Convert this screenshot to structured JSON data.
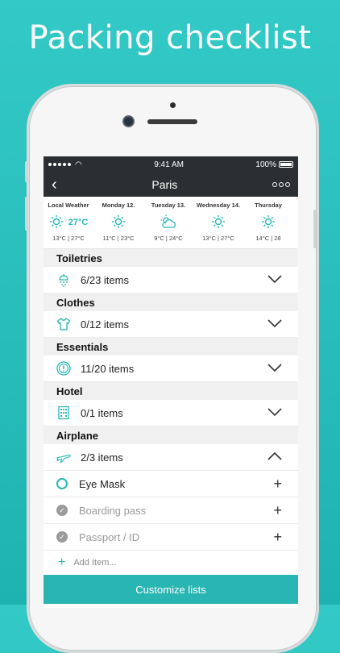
{
  "headline": "Packing checklist",
  "status": {
    "time": "9:41 AM",
    "battery": "100%"
  },
  "nav": {
    "title": "Paris"
  },
  "weather": [
    {
      "day": "Local Weather",
      "icon": "sun-icon",
      "temp": "27°C",
      "range": "13°C | 27°C"
    },
    {
      "day": "Monday 12.",
      "icon": "sun-icon",
      "temp": "",
      "range": "11°C | 23°C"
    },
    {
      "day": "Tuesday 13.",
      "icon": "cloudy-sun-icon",
      "temp": "",
      "range": "9°C | 24°C"
    },
    {
      "day": "Wednesday 14.",
      "icon": "sun-icon",
      "temp": "",
      "range": "13°C | 27°C"
    },
    {
      "day": "Thursday",
      "icon": "sun-icon",
      "temp": "",
      "range": "14°C | 28"
    }
  ],
  "sections": [
    {
      "title": "Toiletries",
      "count": "6/23 items",
      "icon": "shower-icon"
    },
    {
      "title": "Clothes",
      "count": "0/12 items",
      "icon": "tshirt-icon"
    },
    {
      "title": "Essentials",
      "count": "11/20 items",
      "icon": "alert-icon"
    },
    {
      "title": "Hotel",
      "count": "0/1 items",
      "icon": "hotel-icon"
    },
    {
      "title": "Airplane",
      "count": "2/3 items",
      "icon": "airplane-icon"
    }
  ],
  "airplane_items": [
    {
      "label": "Eye Mask",
      "checked": false
    },
    {
      "label": "Boarding pass",
      "checked": true
    },
    {
      "label": "Passport / ID",
      "checked": true
    }
  ],
  "add_item_placeholder": "Add Item...",
  "customize_label": "Customize lists",
  "colors": {
    "accent": "#25b8b5",
    "nav": "#2b2f33",
    "background": "#2ec3c0"
  }
}
